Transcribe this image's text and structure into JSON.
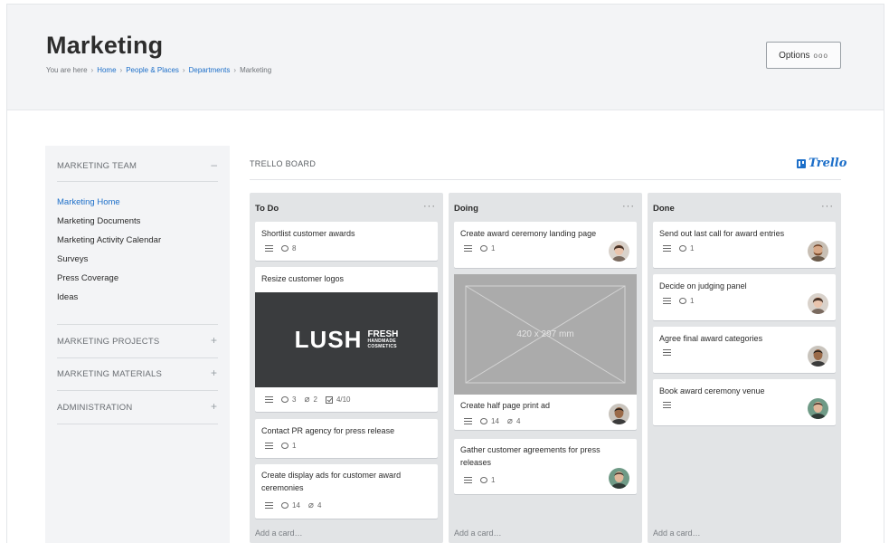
{
  "page": {
    "title": "Marketing",
    "breadcrumb": {
      "prefix": "You are here",
      "items": [
        "Home",
        "People & Places",
        "Departments"
      ],
      "current": "Marketing"
    },
    "options_label": "Options",
    "options_dots": "ooo"
  },
  "sidebar": {
    "team_heading": "MARKETING TEAM",
    "collapse_symbol": "–",
    "expand_symbol": "+",
    "items": [
      {
        "label": "Marketing Home"
      },
      {
        "label": "Marketing Documents"
      },
      {
        "label": "Marketing Activity Calendar"
      },
      {
        "label": "Surveys"
      },
      {
        "label": "Press Coverage"
      },
      {
        "label": "Ideas"
      }
    ],
    "sections": [
      {
        "label": "MARKETING PROJECTS"
      },
      {
        "label": "MARKETING MATERIALS"
      },
      {
        "label": "ADMINISTRATION"
      }
    ]
  },
  "board": {
    "title": "TRELLO BOARD",
    "logo_text": "Trello",
    "add_card": "Add a card…",
    "menu_dots": "···",
    "lists": [
      {
        "title": "To Do",
        "cards": [
          {
            "title": "Shortlist customer awards",
            "comments": "8"
          },
          {
            "title": "Resize customer logos",
            "cover_brand": "LUSH",
            "cover_line1": "FRESH",
            "cover_line2": "HANDMADE",
            "cover_line3": "COSMETICS",
            "comments": "3",
            "attachments": "2",
            "checklist": "4/10"
          },
          {
            "title": "Contact PR agency for press release",
            "comments": "1"
          },
          {
            "title": "Create display ads for customer award ceremonies",
            "comments": "14",
            "attachments": "4"
          }
        ]
      },
      {
        "title": "Doing",
        "cards": [
          {
            "title": "Create award ceremony landing page",
            "comments": "1",
            "avatar": "woman"
          },
          {
            "title": "Create half page print ad",
            "cover_text": "420 x 297 mm",
            "comments": "14",
            "attachments": "4",
            "avatar": "man-dark"
          },
          {
            "title": "Gather customer agreements for press releases",
            "comments": "1",
            "avatar": "man-green"
          }
        ]
      },
      {
        "title": "Done",
        "cards": [
          {
            "title": "Send out last call for award entries",
            "comments": "1",
            "avatar": "man-beard"
          },
          {
            "title": "Decide on judging panel",
            "comments": "1",
            "avatar": "woman"
          },
          {
            "title": "Agree final award categories",
            "avatar": "man-dark"
          },
          {
            "title": "Book award ceremony venue",
            "avatar": "man-green"
          }
        ]
      }
    ]
  },
  "colors": {
    "accent": "#1d6fc9",
    "header_bg": "#f3f4f6",
    "list_bg": "#e2e4e6",
    "lush_bg": "#3a3c3e",
    "placeholder_bg": "#ababab"
  }
}
